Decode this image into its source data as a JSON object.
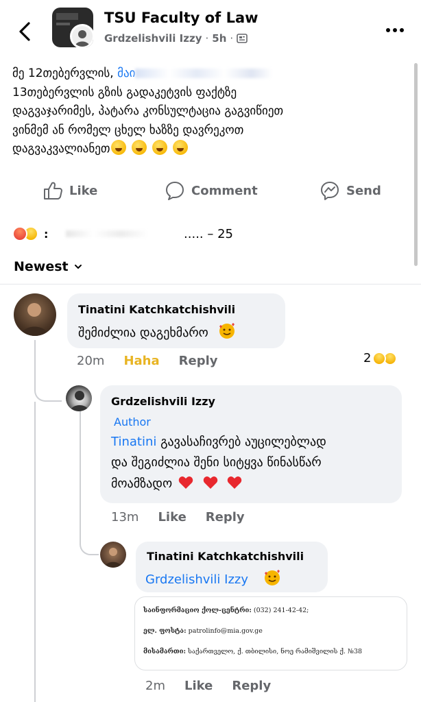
{
  "header": {
    "group_name": "TSU Faculty of Law",
    "author": "Grdzelishvili Izzy",
    "time": "5h",
    "dot": "·"
  },
  "post": {
    "lines": [
      "მე 12თებერვლის, ",
      "13თებერვლის გზის გადაკეტვის ფაქტზე",
      "დაგვაჯარიმეს, პატარა კონსულტაცია გაგვიწიეთ",
      "ვინმემ ან რომელ ცხელ ხაზზე დავრეკოთ",
      "დაგვაკვალიანეთ"
    ],
    "line1_blurred_start": "მაი"
  },
  "actions": {
    "like": "Like",
    "comment": "Comment",
    "send": "Send"
  },
  "reactions": {
    "colon": ":",
    "count_text": "..... – 25"
  },
  "sort": {
    "label": "Newest"
  },
  "comments": [
    {
      "name": "Tinatini Katchkatchishvili",
      "text": "შემიძლია დაგეხმარო",
      "time": "20m",
      "reaction_label": "Haha",
      "reply_label": "Reply",
      "reaction_count": "2"
    },
    {
      "name": "Grdzelishvili Izzy",
      "tag": "Author",
      "mention": "Tinatini",
      "lines": [
        " გავასაჩივრებ აუცილებლად",
        "და შეგიძლია შენი სიტყვა წინასწარ",
        "მოამზადო"
      ],
      "time": "13m",
      "like_label": "Like",
      "reply_label": "Reply"
    },
    {
      "name": "Tinatini Katchkatchishvili",
      "mention": "Grdzelishvili Izzy",
      "time": "2m",
      "like_label": "Like",
      "reply_label": "Reply"
    }
  ],
  "attachment": {
    "line1_label": "საინფორმაციო ქოლ-ცენტრი:",
    "line1_value": " (032) 241-42-42;",
    "line2_label": "ელ. ფოსტა:",
    "line2_value": " patrolinfo@mia.gov.ge",
    "line3_label": "მისამართი:",
    "line3_value": " საქართველო, ქ. თბილისი, ნოე რამიშვილის ქ. №38"
  },
  "colors": {
    "accent": "#1877f2",
    "muted": "#65676b",
    "haha": "#e8b423",
    "bubble": "#f0f2f5"
  },
  "icons": {
    "back": "chevron-left-icon",
    "more": "more-dots-icon",
    "like": "thumbs-up-icon",
    "comment": "comment-bubble-icon",
    "send": "messenger-icon",
    "sort": "chevron-down-icon"
  }
}
